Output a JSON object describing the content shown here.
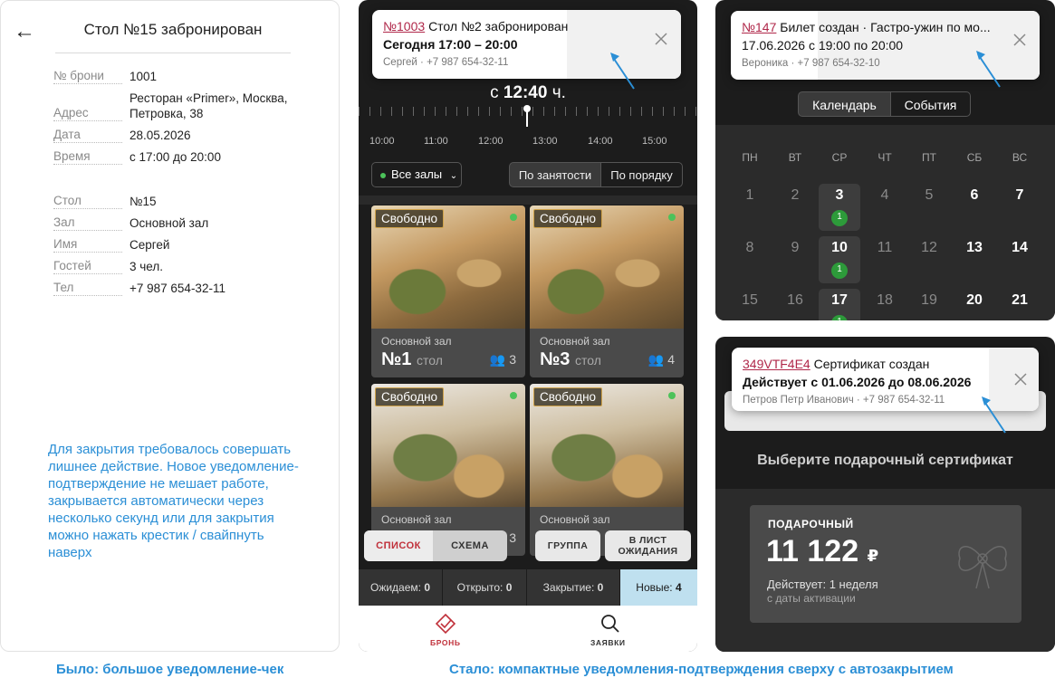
{
  "old_receipt": {
    "back_icon": "arrow-left-icon",
    "title": "Стол №15 забронирован",
    "rows": [
      {
        "k": "№ брони",
        "v": "1001"
      },
      {
        "k": "Адрес",
        "v": "Ресторан «Primer», Москва, Петровка, 38"
      },
      {
        "k": "Дата",
        "v": "28.05.2026"
      },
      {
        "k": "Время",
        "v": "с 17:00 до 20:00"
      },
      {
        "k": "Стол",
        "v": "№15"
      },
      {
        "k": "Зал",
        "v": "Основной зал"
      },
      {
        "k": "Имя",
        "v": "Сергей"
      },
      {
        "k": "Гостей",
        "v": "3 чел."
      },
      {
        "k": "Тел",
        "v": "+7 987 654-32-11"
      }
    ],
    "note": "Для закрытия требовалось совершать лишнее действие. Новое уведомление-подтверждение не мешает работе, закрывается автоматически через несколько секунд или для закрытия можно нажать крестик / свайпнуть наверх"
  },
  "booking_app": {
    "toast": {
      "id": "№1003",
      "title": "Стол №2 забронирован",
      "time": "Сегодня 17:00 – 20:00",
      "meta": "Сергей · +7 987 654-32-11"
    },
    "now_prefix": "с",
    "now_time": "12:40",
    "now_suffix": "ч.",
    "timeline": [
      "10:00",
      "11:00",
      "12:00",
      "13:00",
      "14:00",
      "15:00"
    ],
    "hall_filter": "Все залы",
    "sort_tabs": [
      "По занятости",
      "По порядку"
    ],
    "cards": [
      {
        "badge": "Свободно",
        "hall": "Основной зал",
        "num": "№1",
        "unit": "стол",
        "guests": "3"
      },
      {
        "badge": "Свободно",
        "hall": "Основной зал",
        "num": "№3",
        "unit": "стол",
        "guests": "4"
      },
      {
        "badge": "Свободно",
        "hall": "Основной зал",
        "num": "",
        "unit": "",
        "guests": "3"
      },
      {
        "badge": "Свободно",
        "hall": "Основной зал",
        "num": "",
        "unit": "",
        "guests": ""
      }
    ],
    "view_toggle": [
      "СПИСОК",
      "СХЕМА"
    ],
    "group_btn": "ГРУППА",
    "waitlist_btn_1": "В ЛИСТ",
    "waitlist_btn_2": "ОЖИДАНИЯ",
    "statuses": [
      {
        "label": "Ожидаем:",
        "count": "0"
      },
      {
        "label": "Открыто:",
        "count": "0"
      },
      {
        "label": "Закрытие:",
        "count": "0"
      },
      {
        "label": "Новые:",
        "count": "4"
      }
    ],
    "tabs": [
      {
        "label": "БРОНЬ",
        "icon": "table-booking-icon"
      },
      {
        "label": "ЗАЯВКИ",
        "icon": "search-icon"
      }
    ],
    "accent": "#b0284a"
  },
  "calendar_app": {
    "toast": {
      "id": "№147",
      "title": "Билет создан · Гастро-ужин по мо...",
      "time": "17.06.2026 с 19:00 по 20:00",
      "meta": "Вероника · +7 987 654-32-10"
    },
    "tabs": [
      "Календарь",
      "События"
    ],
    "weekdays": [
      "ПН",
      "ВТ",
      "СР",
      "ЧТ",
      "ПТ",
      "СБ",
      "ВС"
    ],
    "weeks": [
      [
        "1",
        "2",
        "3",
        "4",
        "5",
        "6",
        "7"
      ],
      [
        "8",
        "9",
        "10",
        "11",
        "12",
        "13",
        "14"
      ],
      [
        "15",
        "16",
        "17",
        "18",
        "19",
        "20",
        "21"
      ]
    ],
    "event_counts": [
      "1",
      "1",
      "1"
    ]
  },
  "cert_app": {
    "toast": {
      "id": "349VTF4E4",
      "title": "Сертификат создан",
      "time": "Действует с 01.06.2026 до 08.06.2026",
      "meta": "Петров Петр Иванович · +7 987 654-32-11"
    },
    "heading": "Выберите подарочный сертификат",
    "card": {
      "label": "ПОДАРОЧНЫЙ",
      "amount": "11 122",
      "currency": "₽",
      "valid": "Действует: 1 неделя",
      "valid_from": "с даты активации"
    }
  },
  "captions": {
    "before": "Было: большое уведомление-чек",
    "after": "Стало: компактные уведомления-подтверждения сверху с автозакрытием"
  },
  "colors": {
    "caption_blue": "#2b8fd6",
    "free_dot_green": "#4cc25a",
    "event_green": "#2d9b3a",
    "new_status_bg": "#bfe0ef"
  }
}
